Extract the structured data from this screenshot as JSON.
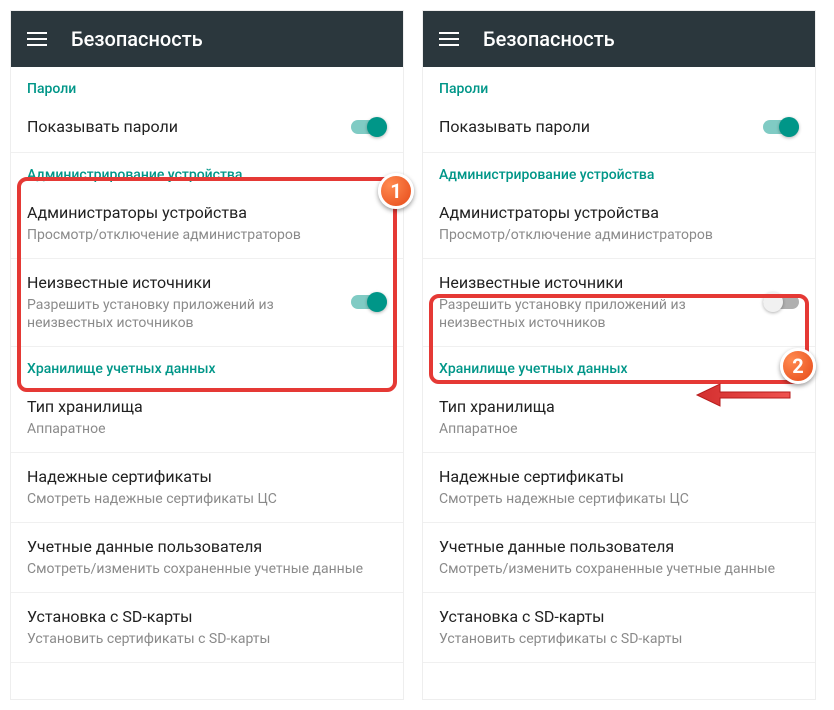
{
  "appbar": {
    "title": "Безопасность"
  },
  "sections": {
    "passwords": {
      "header": "Пароли",
      "show_passwords": {
        "title": "Показывать пароли"
      }
    },
    "admin": {
      "header": "Администрирование устройства",
      "device_admins": {
        "title": "Администраторы устройства",
        "sub": "Просмотр/отключение администраторов"
      },
      "unknown_sources": {
        "title": "Неизвестные источники",
        "sub": "Разрешить установку приложений из неизвестных источников"
      }
    },
    "credentials": {
      "header": "Хранилище учетных данных",
      "storage_type": {
        "title": "Тип хранилища",
        "sub": "Аппаратное"
      },
      "trusted_certs": {
        "title": "Надежные сертификаты",
        "sub": "Смотреть надежные сертификаты ЦС"
      },
      "user_creds": {
        "title": "Учетные данные пользователя",
        "sub": "Смотреть/изменить сохраненные учетные данные"
      },
      "sd_install": {
        "title": "Установка с SD-карты",
        "sub": "Установить сертификаты с SD-карты"
      }
    }
  },
  "badges": {
    "one": "1",
    "two": "2"
  }
}
